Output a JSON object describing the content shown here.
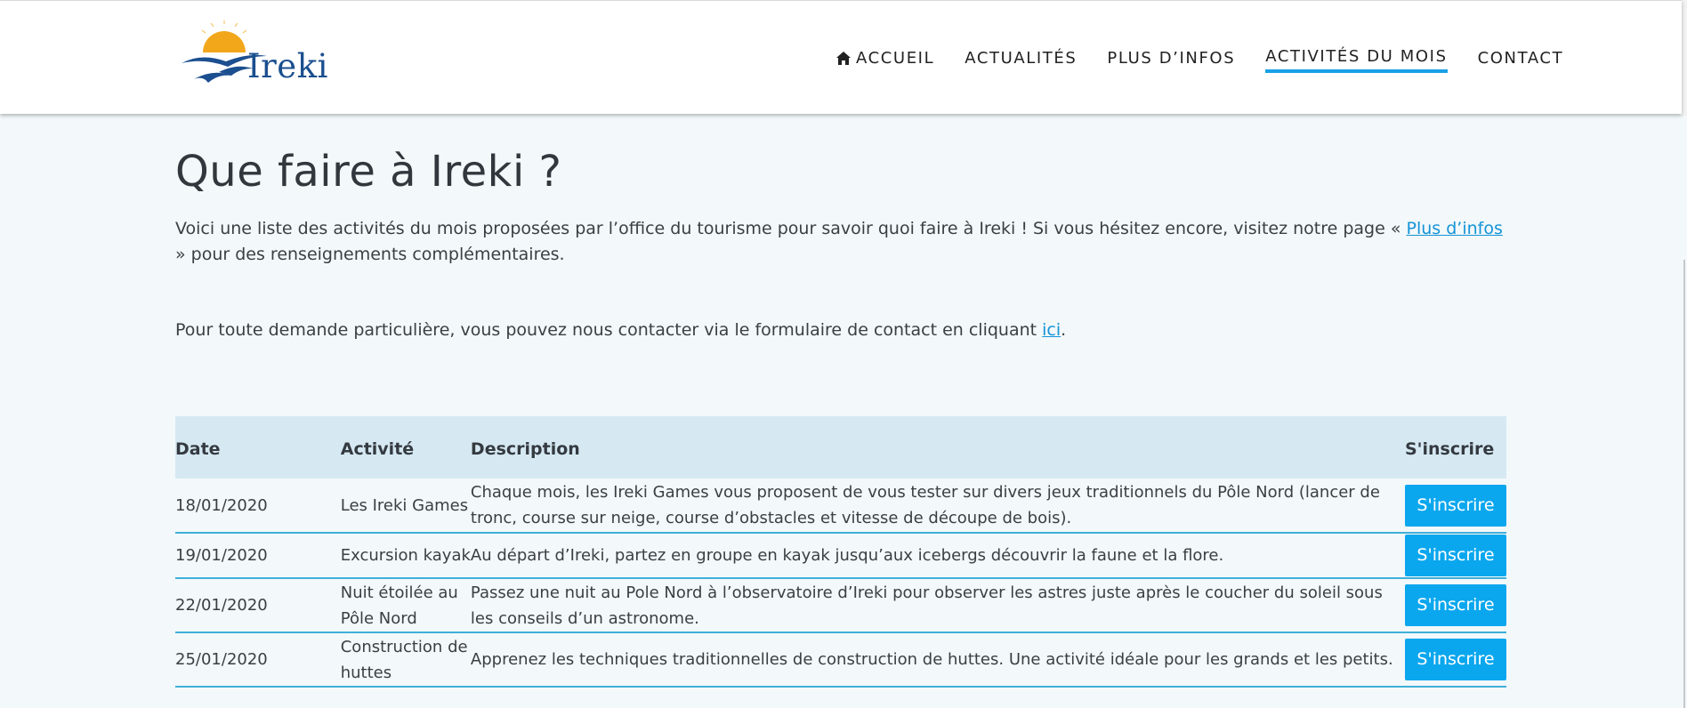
{
  "header": {
    "logo_text": "Ireki",
    "nav": [
      {
        "label": "ACCUEIL",
        "icon": "home-icon"
      },
      {
        "label": "ACTUALITÉS"
      },
      {
        "label": "PLUS D’INFOS"
      },
      {
        "label": "ACTIVITÉS DU MOIS",
        "active": true
      },
      {
        "label": "CONTACT"
      }
    ]
  },
  "main": {
    "title": "Que faire à Ireki ?",
    "intro_before": "Voici une liste des activités du mois proposées par l’office du tourisme pour savoir quoi faire à Ireki ! Si vous hésitez encore, visitez notre page « ",
    "intro_link": "Plus d’infos",
    "intro_after": " » pour des renseignements complémentaires.",
    "contact_before": "Pour toute demande particulière, vous pouvez nous contacter via le formulaire de contact en cliquant ",
    "contact_link": "ici",
    "contact_after": "."
  },
  "table": {
    "headers": {
      "date": "Date",
      "activity": "Activité",
      "description": "Description",
      "register": "S'inscrire"
    },
    "rows": [
      {
        "date": "18/01/2020",
        "activity": "Les Ireki Games",
        "description": "Chaque mois, les Ireki Games vous proposent de vous tester sur divers jeux traditionnels du Pôle Nord (lancer de tronc, course sur neige, course d’obstacles et vitesse de découpe de bois).",
        "button": "S'inscrire"
      },
      {
        "date": "19/01/2020",
        "activity": "Excursion kayak",
        "description": "Au départ d’Ireki, partez en groupe en kayak jusqu’aux icebergs découvrir la faune et la flore.",
        "button": "S'inscrire"
      },
      {
        "date": "22/01/2020",
        "activity": "Nuit étoilée au Pôle Nord",
        "description": "Passez une nuit au Pole Nord à l’observatoire d’Ireki pour observer les astres juste après le coucher du soleil sous les conseils d’un astronome.",
        "button": "S'inscrire"
      },
      {
        "date": "25/01/2020",
        "activity": "Construction de huttes",
        "description": "Apprenez les techniques traditionnelles de construction de huttes. Une activité idéale pour les grands et les petits.",
        "button": "S'inscrire"
      }
    ]
  },
  "colors": {
    "accent": "#0ba7ee",
    "header_row": "#d6e9f3",
    "page_bg": "#f3f8fa",
    "logo_blue": "#1b4f8f",
    "sun": "#f2a71b"
  }
}
